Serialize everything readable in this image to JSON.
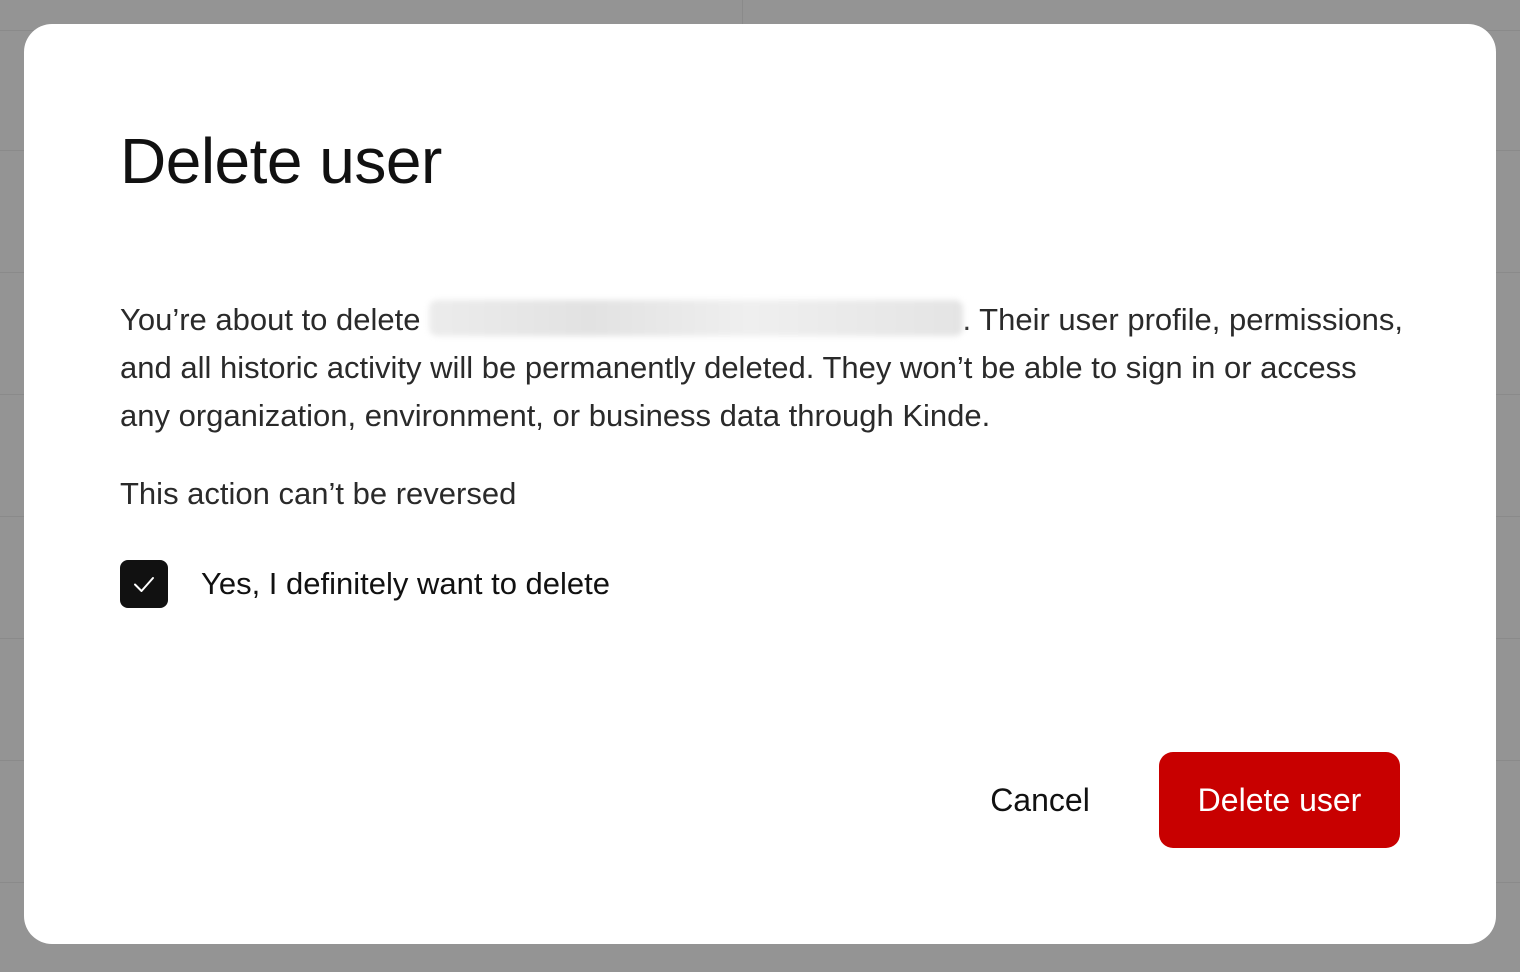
{
  "dialog": {
    "title": "Delete user",
    "body_prefix": "You’re about to delete",
    "body_suffix": ". Their user profile, permissions, and all historic activity will be permanently deleted. They won’t be able to sign in or access any organization, environment, or business data through Kinde.",
    "warning": "This action can’t be reversed",
    "confirm_checkbox": {
      "label": "Yes, I definitely want to delete",
      "checked": true
    },
    "cancel_label": "Cancel",
    "delete_label": "Delete user"
  },
  "colors": {
    "danger": "#c80000",
    "checkbox": "#111111",
    "overlay": "#949494"
  },
  "icons": {
    "checkmark": "check-icon"
  }
}
